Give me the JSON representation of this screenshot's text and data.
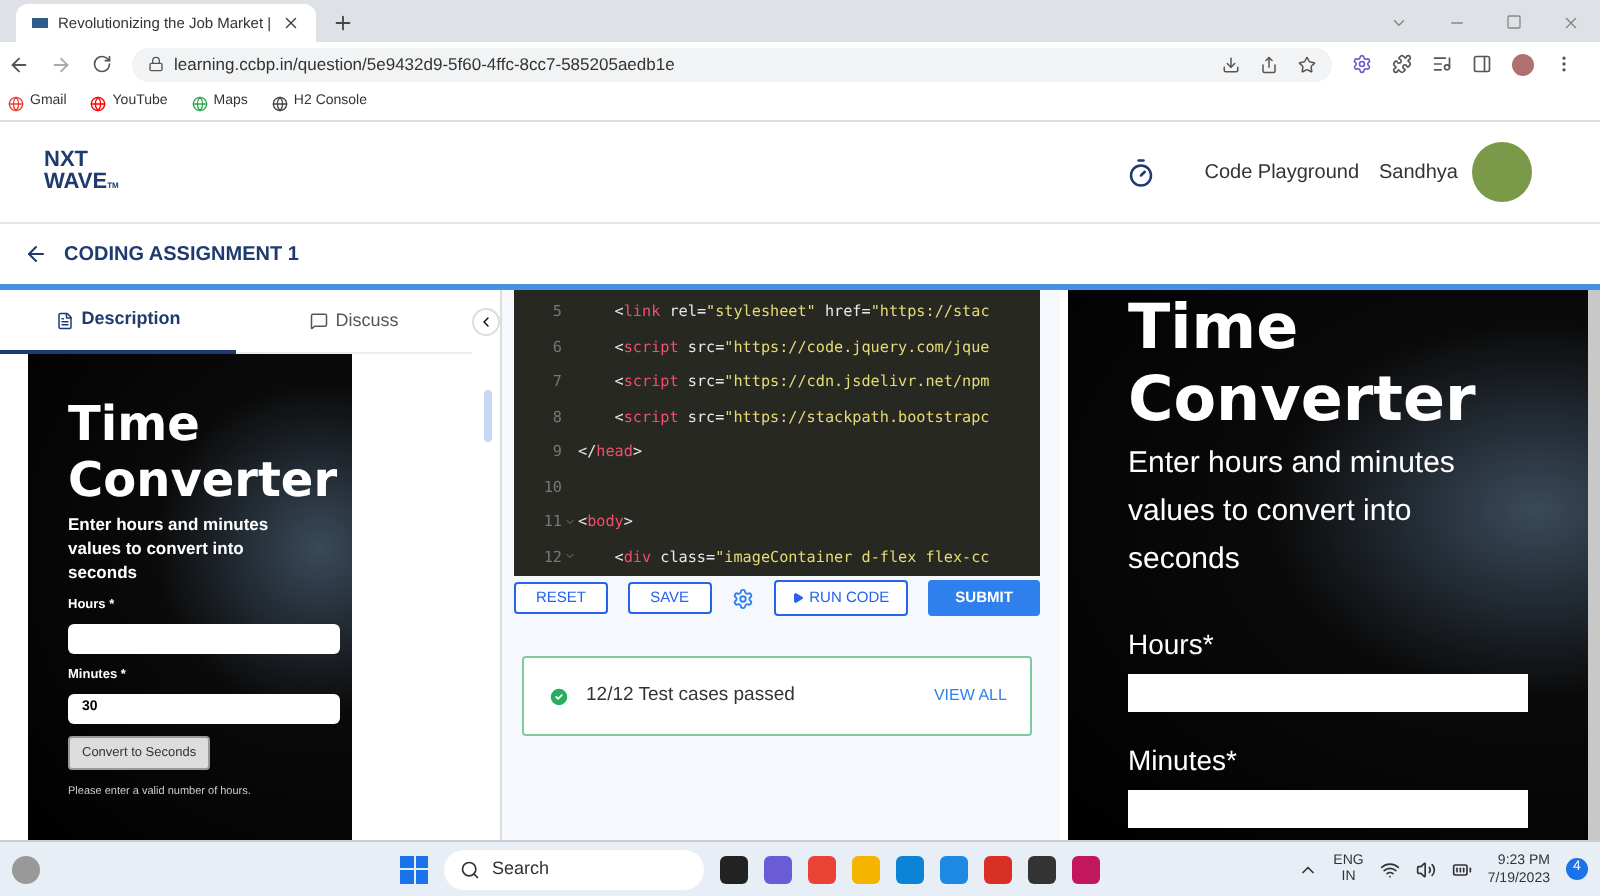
{
  "browser": {
    "tab_title": "Revolutionizing the Job Market |",
    "url": "learning.ccbp.in/question/5e9432d9-5f60-4ffc-8cc7-585205aedb1e",
    "bookmarks": [
      "Gmail",
      "YouTube",
      "Maps",
      "H2 Console"
    ]
  },
  "header": {
    "logo_top": "NXT",
    "logo_bottom": "WAVE",
    "logo_tm": "TM",
    "link": "Code Playground",
    "user": "Sandhya"
  },
  "assignment": {
    "title": "CODING ASSIGNMENT 1"
  },
  "left_tabs": [
    {
      "label": "Description",
      "selected": true
    },
    {
      "label": "Discuss",
      "selected": false
    }
  ],
  "preview_small": {
    "title": "Time Converter",
    "subtitle": "Enter hours and minutes values to convert into seconds",
    "hours_label": "Hours *",
    "minutes_label": "Minutes *",
    "minutes_value": "30",
    "button": "Convert to Seconds",
    "error": "Please enter a valid number of hours."
  },
  "editor": {
    "lines": [
      {
        "number": "5",
        "fold": false,
        "parts": [
          {
            "kind": "plain",
            "text": "    <"
          },
          {
            "kind": "tag",
            "text": "link"
          },
          {
            "kind": "plain",
            "text": " rel="
          },
          {
            "kind": "string",
            "text": "\"stylesheet\""
          },
          {
            "kind": "plain",
            "text": " href="
          },
          {
            "kind": "string",
            "text": "\"https://stac"
          }
        ]
      },
      {
        "number": "6",
        "fold": false,
        "parts": [
          {
            "kind": "plain",
            "text": "    <"
          },
          {
            "kind": "tag",
            "text": "script"
          },
          {
            "kind": "plain",
            "text": " src="
          },
          {
            "kind": "string",
            "text": "\"https://code.jquery.com/jque"
          }
        ]
      },
      {
        "number": "7",
        "fold": false,
        "parts": [
          {
            "kind": "plain",
            "text": "    <"
          },
          {
            "kind": "tag",
            "text": "script"
          },
          {
            "kind": "plain",
            "text": " src="
          },
          {
            "kind": "string",
            "text": "\"https://cdn.jsdelivr.net/npm"
          }
        ]
      },
      {
        "number": "8",
        "fold": false,
        "parts": [
          {
            "kind": "plain",
            "text": "    <"
          },
          {
            "kind": "tag",
            "text": "script"
          },
          {
            "kind": "plain",
            "text": " src="
          },
          {
            "kind": "string",
            "text": "\"https://stackpath.bootstrapc"
          }
        ]
      },
      {
        "number": "9",
        "fold": false,
        "parts": [
          {
            "kind": "plain",
            "text": "</"
          },
          {
            "kind": "tag",
            "text": "head"
          },
          {
            "kind": "plain",
            "text": ">"
          }
        ]
      },
      {
        "number": "10",
        "fold": false
      },
      {
        "number": "11",
        "fold": true,
        "parts": [
          {
            "kind": "plain",
            "text": "<"
          },
          {
            "kind": "tag",
            "text": "body"
          },
          {
            "kind": "plain",
            "text": ">"
          }
        ]
      },
      {
        "number": "12",
        "fold": true,
        "parts": [
          {
            "kind": "plain",
            "text": "    <"
          },
          {
            "kind": "tag",
            "text": "div"
          },
          {
            "kind": "plain",
            "text": " class="
          },
          {
            "kind": "string",
            "text": "\"imageContainer d-flex flex-cc"
          }
        ]
      }
    ]
  },
  "actions": [
    {
      "label": "RESET",
      "kind": "outline"
    },
    {
      "label": "SAVE",
      "kind": "outline"
    },
    {
      "kind": "settings"
    },
    {
      "label": "RUN CODE",
      "kind": "run"
    },
    {
      "label": "SUBMIT",
      "kind": "primary"
    }
  ],
  "result": {
    "text": "12/12 Test cases passed",
    "link": "VIEW ALL"
  },
  "preview_large": {
    "title": "Time Converter",
    "subtitle": "Enter hours and minutes values to convert into seconds",
    "hours_label": "Hours*",
    "minutes_label": "Minutes*"
  },
  "taskbar": {
    "search": "Search",
    "language_top": "ENG",
    "language_bottom": "IN",
    "time": "9:23 PM",
    "date": "7/19/2023",
    "notifications": "4"
  }
}
